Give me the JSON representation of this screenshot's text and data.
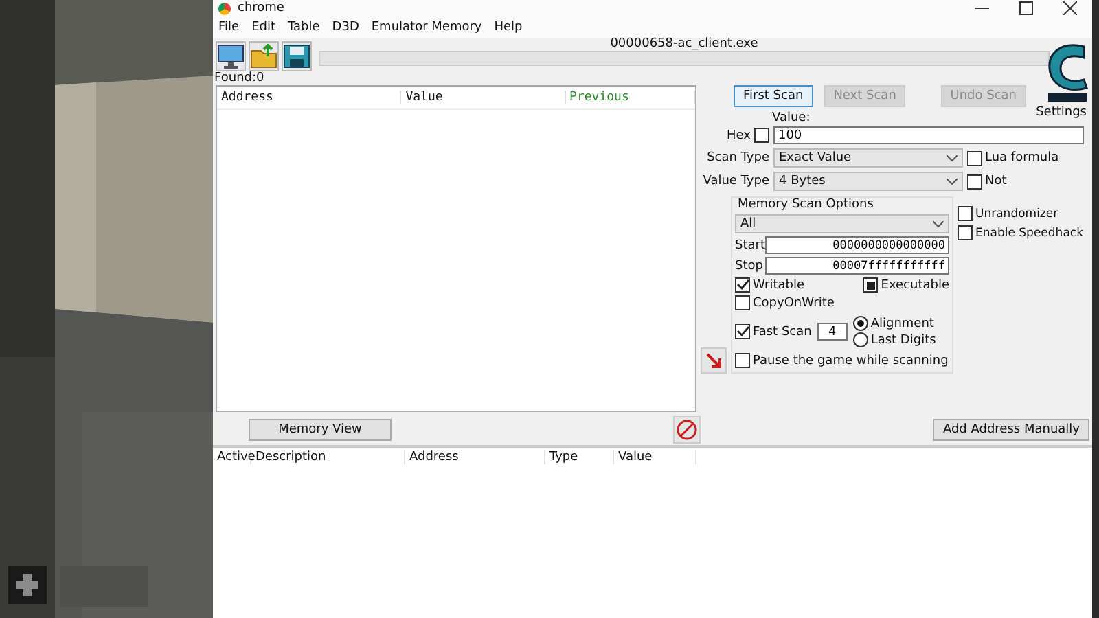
{
  "window": {
    "title": "chrome",
    "process": "00000658-ac_client.exe"
  },
  "menu": [
    "File",
    "Edit",
    "Table",
    "D3D",
    "Emulator Memory",
    "Help"
  ],
  "progress": {
    "level": 0
  },
  "found": "Found:0",
  "results_columns": [
    "Address",
    "Value",
    "Previous"
  ],
  "scan_buttons": [
    {
      "label": "First Scan",
      "disabled": false
    },
    {
      "label": "Next Scan",
      "disabled": true
    }
  ],
  "undo_button": {
    "label": "Undo Scan",
    "disabled": true
  },
  "settings_label": "Settings",
  "value_label": "Value:",
  "hex": {
    "label": "Hex",
    "checked": false
  },
  "value": "100",
  "scan_type": {
    "label": "Scan Type",
    "value": "Exact Value"
  },
  "value_type": {
    "label": "Value Type",
    "value": "4 Bytes"
  },
  "side_options": [
    {
      "label": "Lua formula",
      "checked": false
    },
    {
      "label": "Not",
      "checked": false
    }
  ],
  "extra_options": [
    {
      "label": "Unrandomizer",
      "checked": false
    },
    {
      "label": "Enable Speedhack",
      "checked": false
    }
  ],
  "memory_scan_options": {
    "title": "Memory Scan Options",
    "region": "All",
    "start_label": "Start",
    "start": "0000000000000000",
    "stop_label": "Stop",
    "stop": "00007fffffffffff",
    "writable": {
      "label": "Writable",
      "checked": true
    },
    "executable": {
      "label": "Executable",
      "checked": true,
      "kind": "square"
    },
    "copy_on_write": {
      "label": "CopyOnWrite",
      "checked": false
    },
    "fast_scan": {
      "label": "Fast Scan",
      "checked": true,
      "value": "4"
    },
    "alignment": [
      {
        "label": "Alignment",
        "selected": true
      },
      {
        "label": "Last Digits",
        "selected": false
      }
    ],
    "pause": {
      "label": "Pause the game while scanning",
      "checked": false
    }
  },
  "memory_view": "Memory View",
  "add_address": "Add Address Manually",
  "address_columns": [
    "Active",
    "Description",
    "Address",
    "Type",
    "Value"
  ]
}
